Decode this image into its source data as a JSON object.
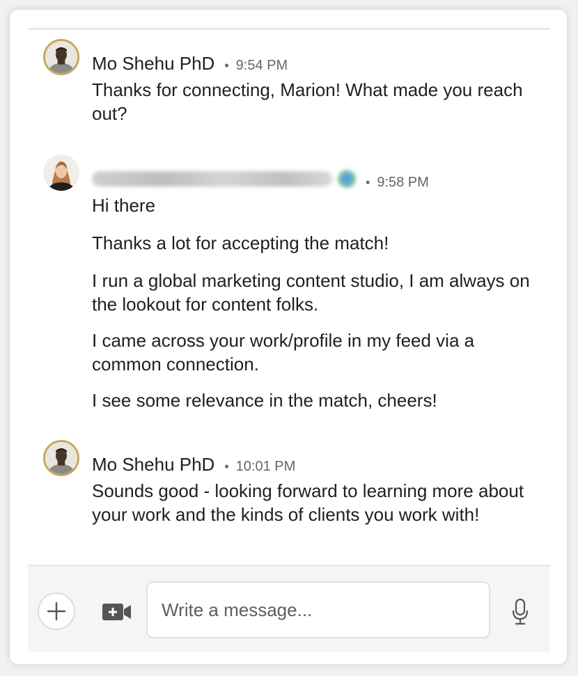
{
  "messages": [
    {
      "sender": "Mo Shehu PhD",
      "sender_blurred": false,
      "time": "9:54 PM",
      "paragraphs": [
        "Thanks for connecting, Marion! What made you reach out?"
      ]
    },
    {
      "sender": "",
      "sender_blurred": true,
      "time": "9:58 PM",
      "paragraphs": [
        "Hi there",
        "Thanks a lot for accepting the match!",
        "I run a global marketing content studio, I am always on the lookout for content folks.",
        "I came across your work/profile in my feed via a common connection.",
        "I see some relevance in the match, cheers!"
      ]
    },
    {
      "sender": "Mo Shehu PhD",
      "sender_blurred": false,
      "time": "10:01 PM",
      "paragraphs": [
        "Sounds good - looking forward to learning more about your work and the kinds of clients you work with!"
      ]
    }
  ],
  "composer": {
    "placeholder": "Write a message...",
    "icons": [
      "plus-icon",
      "video-icon",
      "microphone-icon"
    ]
  },
  "colors": {
    "avatar_ring": "#c9a55c",
    "composer_bg": "#f3f5f7"
  }
}
